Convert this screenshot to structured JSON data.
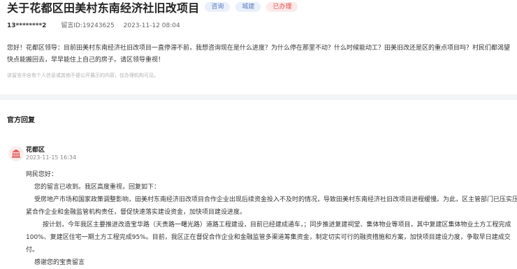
{
  "question": {
    "title": "关于花都区田美村东南经济社旧改项目",
    "tags": [
      "咨询",
      "城建",
      "已办理"
    ],
    "phone": "13********2",
    "message_id": "留言ID:19243625",
    "datetime": "2023-11-12 08:04",
    "content": "您好！花都区领导：目前田美村东南经济社旧改项目一直停滞不前，我想咨询现在是什么进度？为什么停在那里不动？什么时候能动工？田美旧改还是区的重点项目吗？村民们都渴望快点能搬回去，早早能住上自己的房子。请区领导重视！",
    "privacy_note": "该留言中含有个人信息或其他不便公开展示的内容，仅办理机构可见。"
  },
  "official_reply": {
    "heading": "官方回复",
    "department": "花都区",
    "datetime": "2023-11-15 16:34",
    "greeting": "网民您好：",
    "p1": "您的留言已收到。我区高度重视，回复如下：",
    "p2": "受房地产市场和国家政策调整影响，田美村东南经济旧改项目合作企业出现后续资金投入不及时的情况，导致田美村东南经济社旧改项目进程缓慢。为此，区主管部门已压实压紧合作企业和金融监管机构责任，督促快速落实建设资金，加快项目建设进度。",
    "p3": "按计划，今年我区主要推进改造宝华路（天贵路一曙光路）道路工程建设，目前已经建成通车，；同步推进复建祠堂、集体物业等项目，其中复建区集体物业土方工程完成100%、复建区住宅一期土方工程完成95%。目前，我区正在督促合作企业和金融监管多渠道筹集资金，制定切实可行的融资措施和方案，加快项目建设力度，争取早日建成交付。",
    "p4": "感谢您的宝贵留言"
  },
  "colors": {
    "tag_blue_bg": "#e9f0fb",
    "tag_blue_text": "#5b7cc0",
    "tag_red_bg": "#fde9e9",
    "tag_red_text": "#e05050",
    "avatar_icon": "#e04646"
  },
  "icons": {
    "department_avatar": "government-building-icon"
  }
}
